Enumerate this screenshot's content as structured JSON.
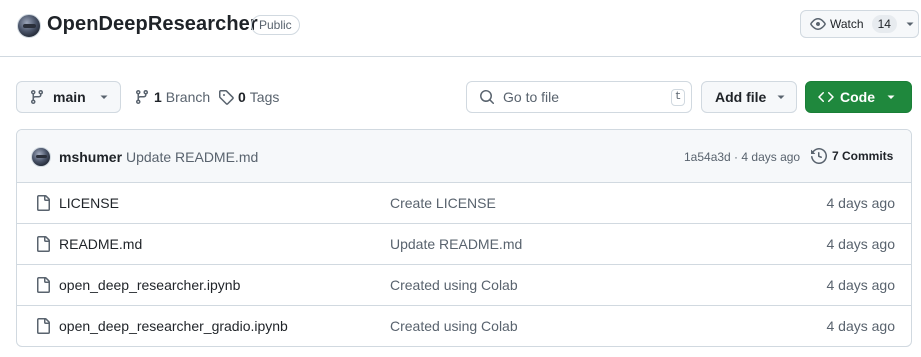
{
  "repo": {
    "name": "OpenDeepResearcher",
    "visibility": "Public"
  },
  "watch": {
    "label": "Watch",
    "count": "14"
  },
  "toolbar": {
    "branch": "main",
    "branch_count": "1",
    "branch_label": "Branch",
    "tag_count": "0",
    "tag_label": "Tags",
    "search_placeholder": "Go to file",
    "search_shortcut": "t",
    "add_file": "Add file",
    "code": "Code"
  },
  "latest_commit": {
    "author": "mshumer",
    "message": "Update README.md",
    "meta": "1a54a3d · 4 days ago",
    "commits_label": "7 Commits"
  },
  "files": [
    {
      "name": "LICENSE",
      "message": "Create LICENSE",
      "date": "4 days ago",
      "icon": "file-icon"
    },
    {
      "name": "README.md",
      "message": "Update README.md",
      "date": "4 days ago",
      "icon": "file-icon"
    },
    {
      "name": "open_deep_researcher.ipynb",
      "message": "Created using Colab",
      "date": "4 days ago",
      "icon": "file-icon"
    },
    {
      "name": "open_deep_researcher_gradio.ipynb",
      "message": "Created using Colab",
      "date": "4 days ago",
      "icon": "file-icon"
    }
  ],
  "colors": {
    "accent_green": "#1f883d",
    "muted_text": "#59636e",
    "border": "#d1d9e0",
    "subtle_bg": "#f6f8fa"
  }
}
